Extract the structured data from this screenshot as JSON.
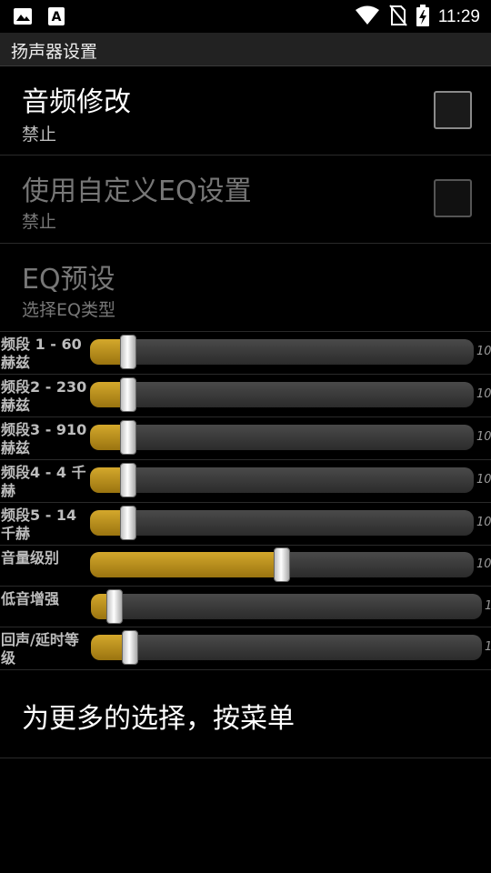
{
  "status_bar": {
    "time": "11:29",
    "icons": [
      "image-icon",
      "text-a-icon",
      "wifi-icon",
      "no-sim-icon",
      "battery-charging-icon"
    ]
  },
  "title": "扬声器设置",
  "prefs": {
    "audio_mod": {
      "title": "音频修改",
      "summary": "禁止",
      "checked": false
    },
    "custom_eq": {
      "title": "使用自定义EQ设置",
      "summary": "禁止",
      "checked": false,
      "enabled": false
    },
    "eq_preset": {
      "title": "EQ预设",
      "summary": "选择EQ类型",
      "enabled": false
    }
  },
  "sliders": [
    {
      "label": "频段 1 - 60 赫兹",
      "max_label": "10",
      "level": 0.1
    },
    {
      "label": "频段2 - 230 赫兹",
      "max_label": "10",
      "level": 0.1
    },
    {
      "label": "频段3 - 910 赫兹",
      "max_label": "10",
      "level": 0.1
    },
    {
      "label": "频段4 - 4 千赫",
      "max_label": "10",
      "level": 0.1
    },
    {
      "label": "频段5 - 14 千赫",
      "max_label": "10",
      "level": 0.1
    },
    {
      "label": "音量级别",
      "max_label": "10",
      "level": 0.5
    },
    {
      "label": "低音增强",
      "max_label": "1",
      "level": 0.06
    },
    {
      "label": "回声/延时等级",
      "max_label": "1",
      "level": 0.1
    }
  ],
  "footer": "为更多的选择，按菜单",
  "colors": {
    "accent": "#c99a1f",
    "background": "#000000",
    "titlebar": "#222222"
  }
}
